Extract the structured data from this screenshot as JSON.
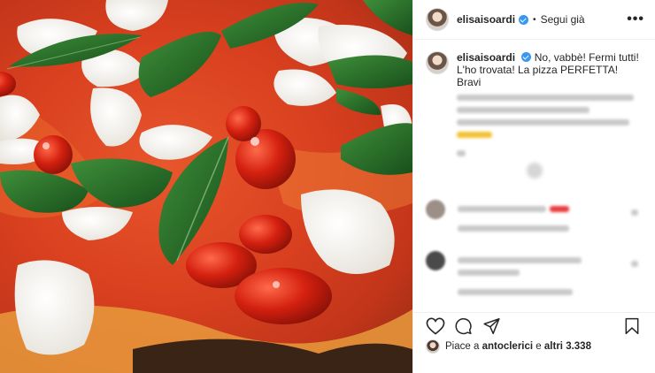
{
  "post": {
    "username": "elisaisoardi",
    "follow_label": "Segui già",
    "dot": "•",
    "more_label": "•••",
    "caption": {
      "username": "elisaisoardi",
      "text": "No, vabbè! Fermi tutti! L'ho trovata! La pizza PERFETTA! Bravi"
    },
    "likes": {
      "prefix": "Piace a ",
      "user": "antoclerici",
      "middle": " e ",
      "others": "altri 3.338"
    }
  },
  "icons": {
    "like": "heart-icon",
    "comment": "comment-icon",
    "share": "send-icon",
    "save": "bookmark-icon",
    "verified": "verified-badge-icon"
  },
  "colors": {
    "accent": "#3897f0",
    "text": "#262626",
    "border": "#efefef"
  }
}
